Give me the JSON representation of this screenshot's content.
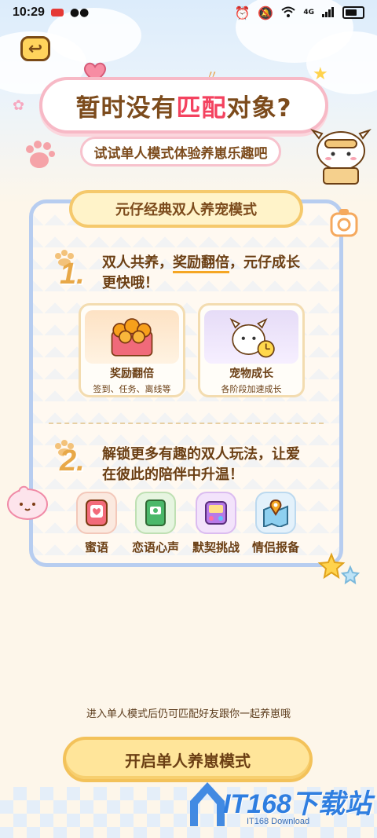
{
  "status_bar": {
    "time": "10:29",
    "network": "4G"
  },
  "header": {
    "title_prefix": "暂时没有",
    "title_highlight": "匹配",
    "title_suffix": "对象?",
    "subtitle": "试试单人模式体验养崽乐趣吧"
  },
  "card": {
    "header": "元仔经典双人养宠模式",
    "step1": {
      "number": "1.",
      "text_a": "双人共养，",
      "text_b": "奖励翻倍",
      "text_c": "，元仔成长",
      "text_d": "更快哦！"
    },
    "features": [
      {
        "title": "奖励翻倍",
        "subtitle": "签到、任务、离线等"
      },
      {
        "title": "宠物成长",
        "subtitle": "各阶段加速成长"
      }
    ],
    "step2": {
      "number": "2.",
      "line1": "解锁更多有趣的双人玩法，让爱",
      "line2": "在彼此的陪伴中升温！"
    },
    "plays": [
      {
        "label": "蜜语",
        "icon": "phone-heart-icon"
      },
      {
        "label": "恋语心声",
        "icon": "green-book-icon"
      },
      {
        "label": "默契挑战",
        "icon": "game-console-icon"
      },
      {
        "label": "情侣报备",
        "icon": "map-pin-icon"
      }
    ]
  },
  "footer": {
    "hint": "进入单人模式后仍可匹配好友跟你一起养崽哦",
    "button": "开启单人养崽模式"
  },
  "watermark": {
    "text": "IT168下载站",
    "sub": "IT168 Download"
  },
  "colors": {
    "brown": "#6b3f14",
    "accent": "#f4425f",
    "gold": "#f5c96c",
    "blue": "#b7cdf0"
  }
}
